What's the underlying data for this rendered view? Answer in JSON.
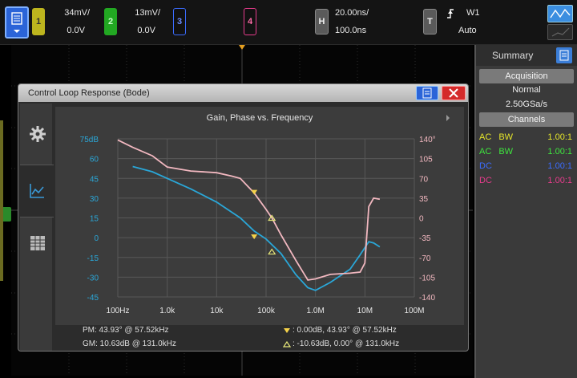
{
  "topbar": {
    "channels": [
      {
        "num": "1",
        "scale": "34mV/",
        "offset": "0.0V",
        "color": "#e6e62a"
      },
      {
        "num": "2",
        "scale": "13mV/",
        "offset": "0.0V",
        "color": "#3ee63e"
      },
      {
        "num": "3",
        "scale": "",
        "offset": "",
        "color": "#3b6cff"
      },
      {
        "num": "4",
        "scale": "",
        "offset": "",
        "color": "#e63c8c"
      }
    ],
    "horizontal": {
      "label": "H",
      "scale": "20.00ns/",
      "delay": "100.0ns"
    },
    "trigger": {
      "label": "T",
      "source": "W1",
      "mode": "Auto"
    }
  },
  "side_panel": {
    "title": "Summary",
    "acquisition_header": "Acquisition",
    "acq_mode": "Normal",
    "sample_rate": "2.50GSa/s",
    "channels_header": "Channels",
    "channel_rows": [
      {
        "coupling": "AC",
        "bw": "BW",
        "ratio": "1.00:1",
        "color": "#e6e62a"
      },
      {
        "coupling": "AC",
        "bw": "BW",
        "ratio": "1.00:1",
        "color": "#3ee63e"
      },
      {
        "coupling": "DC",
        "bw": "",
        "ratio": "1.00:1",
        "color": "#3b6cff"
      },
      {
        "coupling": "DC",
        "bw": "",
        "ratio": "1.00:1",
        "color": "#e63c8c"
      }
    ]
  },
  "window": {
    "title": "Control Loop Response (Bode)",
    "pm_text": "PM:  43.93° @ 57.52kHz",
    "gm_text": "GM:  10.63dB @ 131.0kHz",
    "cursor1_text": ":  0.00dB, 43.93° @ 57.52kHz",
    "cursor2_text": ":  -10.63dB, 0.00° @ 131.0kHz"
  },
  "chart_data": {
    "type": "line",
    "title": "Gain, Phase vs. Frequency",
    "x_scale": "log",
    "x_ticks": [
      "100Hz",
      "1.0k",
      "10k",
      "100k",
      "1.0M",
      "10M",
      "100M"
    ],
    "x_tick_values": [
      100,
      1000,
      10000,
      100000,
      1000000,
      10000000,
      100000000
    ],
    "y_left_ticks": [
      "75dB",
      "60",
      "45",
      "30",
      "15",
      "0",
      "-15",
      "-30",
      "-45"
    ],
    "y_left_range": [
      -45,
      75
    ],
    "y_right_ticks": [
      "140°",
      "105",
      "70",
      "35",
      "0",
      "-35",
      "-70",
      "-105",
      "-140"
    ],
    "y_right_range": [
      -140,
      140
    ],
    "colors": {
      "gain": "#2aa7d8",
      "phase": "#f2b8c0"
    },
    "series": [
      {
        "axis": "left",
        "x": [
          200,
          500,
          1000,
          3000,
          10000,
          30000,
          57520,
          100000,
          200000,
          400000,
          700000,
          1000000,
          2000000,
          5000000,
          8000000,
          12000000,
          15000000,
          20000000
        ],
        "y": [
          54,
          50,
          45,
          37,
          27,
          15,
          5,
          -1,
          -12,
          -28,
          -38,
          -40,
          -34,
          -24,
          -13,
          -3,
          -4,
          -7
        ]
      },
      {
        "axis": "right",
        "x": [
          100,
          200,
          500,
          1000,
          3000,
          10000,
          20000,
          30000,
          57520,
          100000,
          131000,
          200000,
          400000,
          700000,
          1000000,
          2000000,
          5000000,
          8000000,
          10000000,
          12000000,
          15000000,
          20000000
        ],
        "y": [
          138,
          125,
          110,
          90,
          83,
          80,
          74,
          70,
          44,
          15,
          0,
          -30,
          -75,
          -110,
          -108,
          -100,
          -98,
          -96,
          -80,
          20,
          35,
          33
        ]
      }
    ]
  }
}
